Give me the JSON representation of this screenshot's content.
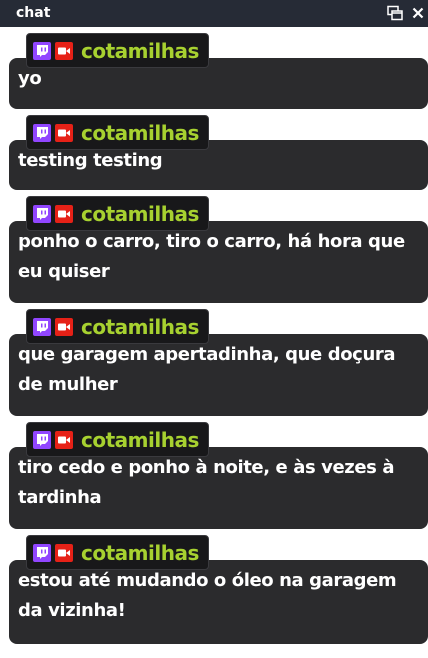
{
  "window": {
    "title": "chat",
    "popout_icon": "popout-window-icon",
    "close_icon": "close-icon"
  },
  "colors": {
    "username": "#a7d130",
    "twitch": "#9146ff",
    "youtube": "#e62117",
    "bubble": "#2b2b2d",
    "titlebar": "#262b36"
  },
  "messages": [
    {
      "username": "cotamilhas",
      "text": "yo"
    },
    {
      "username": "cotamilhas",
      "text": "testing testing"
    },
    {
      "username": "cotamilhas",
      "text": "ponho o carro, tiro o carro, há hora que eu quiser"
    },
    {
      "username": "cotamilhas",
      "text": "que garagem apertadinha, que doçura de mulher"
    },
    {
      "username": "cotamilhas",
      "text": "tiro cedo e ponho à noite, e às vezes à tardinha"
    },
    {
      "username": "cotamilhas",
      "text": "estou até mudando o óleo na garagem da vizinha!"
    }
  ]
}
